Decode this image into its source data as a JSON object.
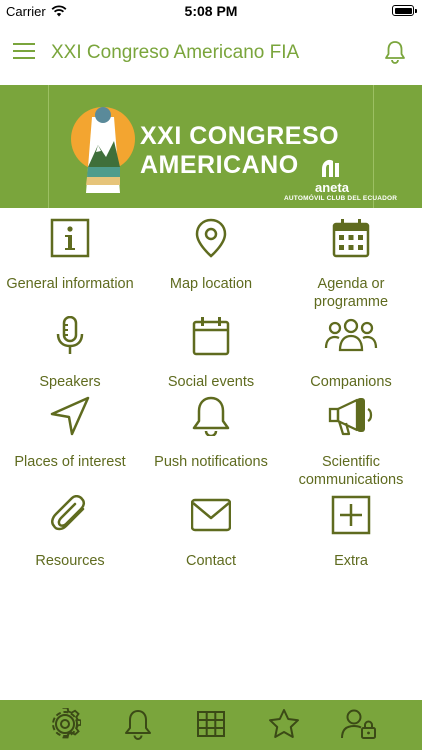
{
  "status_bar": {
    "carrier": "Carrier",
    "time": "5:08 PM"
  },
  "header": {
    "title": "XXI Congreso Americano FIA"
  },
  "banner": {
    "title_line1": "XXI CONGRESO",
    "title_line2": "AMERICANO",
    "brand": "aneta",
    "brand_subtitle": "AUTOMÓVIL CLUB DEL ECUADOR"
  },
  "menu": {
    "items": [
      {
        "label": "General information",
        "icon": "info-icon"
      },
      {
        "label": "Map location",
        "icon": "map-pin-icon"
      },
      {
        "label": "Agenda or programme",
        "icon": "calendar-grid-icon"
      },
      {
        "label": "Speakers",
        "icon": "microphone-icon"
      },
      {
        "label": "Social events",
        "icon": "calendar-icon"
      },
      {
        "label": "Companions",
        "icon": "people-icon"
      },
      {
        "label": "Places of interest",
        "icon": "navigation-arrow-icon"
      },
      {
        "label": "Push notifications",
        "icon": "bell-icon"
      },
      {
        "label": "Scientific communications",
        "icon": "megaphone-icon"
      },
      {
        "label": "Resources",
        "icon": "paperclip-icon"
      },
      {
        "label": "Contact",
        "icon": "envelope-icon"
      },
      {
        "label": "Extra",
        "icon": "plus-square-icon"
      }
    ]
  },
  "tabbar": {
    "tabs": [
      {
        "icon": "gear-icon"
      },
      {
        "icon": "bell-icon"
      },
      {
        "icon": "grid-icon"
      },
      {
        "icon": "star-icon"
      },
      {
        "icon": "user-lock-icon"
      }
    ]
  },
  "colors": {
    "brand_green": "#7aa53c",
    "icon_olive": "#5f6b1f",
    "white": "#ffffff"
  }
}
